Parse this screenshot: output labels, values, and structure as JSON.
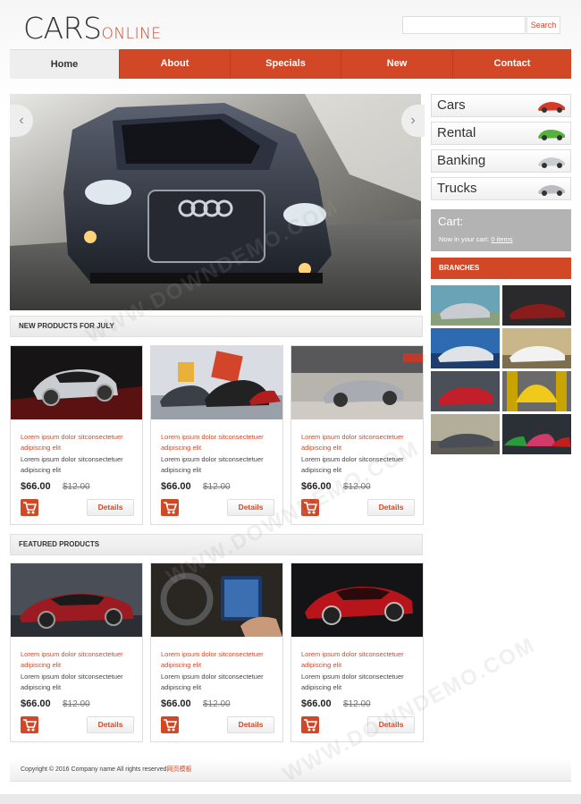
{
  "header": {
    "logo_main": "CARS",
    "logo_sub": "ONLINE",
    "search_placeholder": "",
    "search_label": "Search"
  },
  "nav": {
    "items": [
      {
        "label": "Home",
        "active": true
      },
      {
        "label": "About"
      },
      {
        "label": "Specials"
      },
      {
        "label": "New"
      },
      {
        "label": "Contact"
      }
    ]
  },
  "slider": {
    "prev": "‹",
    "next": "›"
  },
  "sections": {
    "new_products": "NEW PRODUCTS FOR JULY",
    "featured_products": "FEATURED PRODUCTS"
  },
  "new_products": [
    {
      "text1": "Lorem ipsum dolor sitconsectetuer adipiscing elit",
      "text2": "Lorem ipsum dolor sitconsectetuer adipiscing elit",
      "price": "$66.00",
      "old_price": "$12.00",
      "button": "Details"
    },
    {
      "text1": "Lorem ipsum dolor sitconsectetuer adipiscing elit",
      "text2": "Lorem ipsum dolor sitconsectetuer adipiscing elit",
      "price": "$66.00",
      "old_price": "$12.00",
      "button": "Details"
    },
    {
      "text1": "Lorem ipsum dolor sitconsectetuer adipiscing elit",
      "text2": "Lorem ipsum dolor sitconsectetuer adipiscing elit",
      "price": "$66.00",
      "old_price": "$12.00",
      "button": "Details"
    }
  ],
  "featured_products": [
    {
      "text1": "Lorem ipsum dolor sitconsectetuer adipiscing elit",
      "text2": "Lorem ipsum dolor sitconsectetuer adipiscing elit",
      "price": "$66.00",
      "old_price": "$12.00",
      "button": "Details"
    },
    {
      "text1": "Lorem ipsum dolor sitconsectetuer adipiscing elit",
      "text2": "Lorem ipsum dolor sitconsectetuer adipiscing elit",
      "price": "$66.00",
      "old_price": "$12.00",
      "button": "Details"
    },
    {
      "text1": "Lorem ipsum dolor sitconsectetuer adipiscing elit",
      "text2": "Lorem ipsum dolor sitconsectetuer adipiscing elit",
      "price": "$66.00",
      "old_price": "$12.00",
      "button": "Details"
    }
  ],
  "sidebar": {
    "categories": [
      "Cars",
      "Rental",
      "Banking",
      "Trucks"
    ],
    "cart_title": "Cart:",
    "cart_text": "Now in your cart",
    "cart_items": "0 items",
    "branches_title": "BRANCHES"
  },
  "footer": {
    "copyright": "Copyright © 2016 Company name All rights reserved",
    "link": "网页模板"
  },
  "watermark": "WWW.DOWNDEMO.COM",
  "colors": {
    "accent": "#d24726",
    "nav_active": "#eeeeee",
    "cart_box": "#b3b3b3"
  }
}
